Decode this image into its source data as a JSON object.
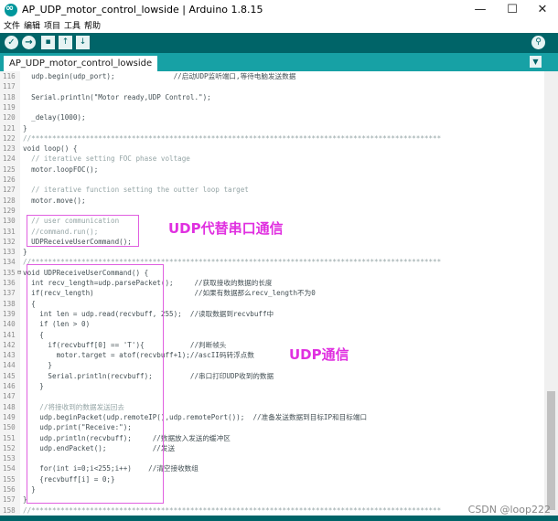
{
  "window": {
    "title": "AP_UDP_motor_control_lowside | Arduino 1.8.15",
    "minimize": "—",
    "maximize": "☐",
    "close": "✕"
  },
  "menu": [
    "文件",
    "编辑",
    "项目",
    "工具",
    "帮助"
  ],
  "toolbar": {
    "verify": "✓",
    "upload": "→",
    "new": "▪",
    "open": "↑",
    "save": "↓",
    "serial_monitor": "⚲"
  },
  "tab": {
    "label": "AP_UDP_motor_control_lowside",
    "menu": "▼"
  },
  "colors": {
    "teal_dark": "#006468",
    "teal_tab": "#17a1a5",
    "annotation": "#e030e0"
  },
  "code_lines": [
    {
      "n": "116",
      "f": "",
      "t": "  udp.begin(udp_port);              //启动UDP监听端口,等待电脑发送数据"
    },
    {
      "n": "117",
      "f": "",
      "t": ""
    },
    {
      "n": "118",
      "f": "",
      "t": "  Serial.println(\"Motor ready,UDP Control.\");"
    },
    {
      "n": "119",
      "f": "",
      "t": ""
    },
    {
      "n": "120",
      "f": "",
      "t": "  _delay(1000);"
    },
    {
      "n": "121",
      "f": "",
      "t": "}"
    },
    {
      "n": "122",
      "f": "",
      "t": "//**************************************************************************************************"
    },
    {
      "n": "123",
      "f": "",
      "t": "void loop() {"
    },
    {
      "n": "124",
      "f": "",
      "t": "  // iterative setting FOC phase voltage"
    },
    {
      "n": "125",
      "f": "",
      "t": "  motor.loopFOC();"
    },
    {
      "n": "126",
      "f": "",
      "t": ""
    },
    {
      "n": "127",
      "f": "",
      "t": "  // iterative function setting the outter loop target"
    },
    {
      "n": "128",
      "f": "",
      "t": "  motor.move();"
    },
    {
      "n": "129",
      "f": "",
      "t": ""
    },
    {
      "n": "130",
      "f": "",
      "t": "  // user communication"
    },
    {
      "n": "131",
      "f": "",
      "t": "  //command.run();"
    },
    {
      "n": "132",
      "f": "",
      "t": "  UDPReceiveUserCommand();"
    },
    {
      "n": "133",
      "f": "",
      "t": "}"
    },
    {
      "n": "134",
      "f": "",
      "t": "//**************************************************************************************************"
    },
    {
      "n": "135",
      "f": "⊟",
      "t": "void UDPReceiveUserCommand() {"
    },
    {
      "n": "136",
      "f": "",
      "t": "  int recv_length=udp.parsePacket();     //获取接收的数据的长度"
    },
    {
      "n": "137",
      "f": "",
      "t": "  if(recv_length)                        //如果有数据那么recv_length不为0"
    },
    {
      "n": "138",
      "f": "",
      "t": "  {"
    },
    {
      "n": "139",
      "f": "",
      "t": "    int len = udp.read(recvbuff, 255);  //读取数据到recvbuff中"
    },
    {
      "n": "140",
      "f": "",
      "t": "    if (len > 0)"
    },
    {
      "n": "141",
      "f": "",
      "t": "    {"
    },
    {
      "n": "142",
      "f": "",
      "t": "      if(recvbuff[0] == 'T'){           //判断帧头"
    },
    {
      "n": "143",
      "f": "",
      "t": "        motor.target = atof(recvbuff+1);//ascII码转浮点数"
    },
    {
      "n": "144",
      "f": "",
      "t": "      }"
    },
    {
      "n": "145",
      "f": "",
      "t": "      Serial.println(recvbuff);         //串口打印UDP收到的数据"
    },
    {
      "n": "146",
      "f": "",
      "t": "    }"
    },
    {
      "n": "147",
      "f": "",
      "t": ""
    },
    {
      "n": "148",
      "f": "",
      "t": "    //将接收到的数据发送回去"
    },
    {
      "n": "149",
      "f": "",
      "t": "    udp.beginPacket(udp.remoteIP(),udp.remotePort());  //准备发送数据到目标IP和目标端口"
    },
    {
      "n": "150",
      "f": "",
      "t": "    udp.print(\"Receive:\");"
    },
    {
      "n": "151",
      "f": "",
      "t": "    udp.println(recvbuff);     //数据放入发送的缓冲区"
    },
    {
      "n": "152",
      "f": "",
      "t": "    udp.endPacket();           //发送"
    },
    {
      "n": "153",
      "f": "",
      "t": ""
    },
    {
      "n": "154",
      "f": "",
      "t": "    for(int i=0;i<255;i++)    //清空接收数组"
    },
    {
      "n": "155",
      "f": "",
      "t": "    {recvbuff[i] = 0;}"
    },
    {
      "n": "156",
      "f": "",
      "t": "  }"
    },
    {
      "n": "157",
      "f": "",
      "t": "}"
    },
    {
      "n": "158",
      "f": "",
      "t": "//**************************************************************************************************"
    }
  ],
  "annotations": {
    "serial_replace": "UDP代替串口通信",
    "udp_comm": "UDP通信"
  },
  "watermark": "CSDN @loop222"
}
